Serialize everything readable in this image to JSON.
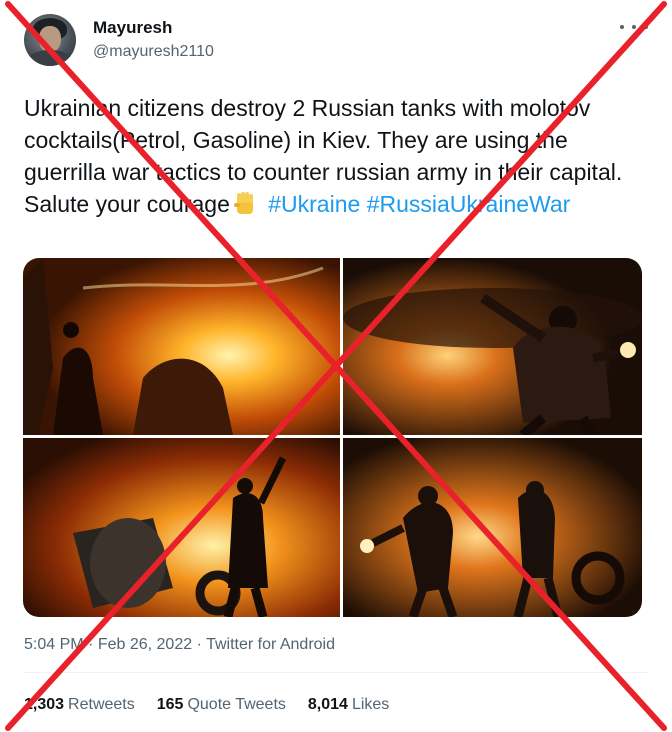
{
  "author": {
    "display_name": "Mayuresh",
    "handle": "@mayuresh2110"
  },
  "tweet": {
    "text_before": "Ukrainian citizens destroy 2 Russian tanks with molotov cocktails(Petrol, Gasoline) in Kiev. They are using the guerrilla war tactics to counter russian army in their capital. Salute your courage",
    "emoji": "raised-fist-icon",
    "hashtags": [
      "#Ukraine",
      "#RussiaUkraineWar"
    ]
  },
  "media": {
    "photos": [
      "photo-1",
      "photo-2",
      "photo-3",
      "photo-4"
    ]
  },
  "meta": {
    "time": "5:04 PM",
    "separator": "·",
    "date": "Feb 26, 2022",
    "source": "Twitter for Android"
  },
  "stats": {
    "retweets_count": "1,303",
    "retweets_label": "Retweets",
    "quotes_count": "165",
    "quotes_label": "Quote Tweets",
    "likes_count": "8,014",
    "likes_label": "Likes"
  },
  "colors": {
    "link": "#1d9bf0",
    "secondary_text": "#536471",
    "cross": "#e8212b"
  }
}
